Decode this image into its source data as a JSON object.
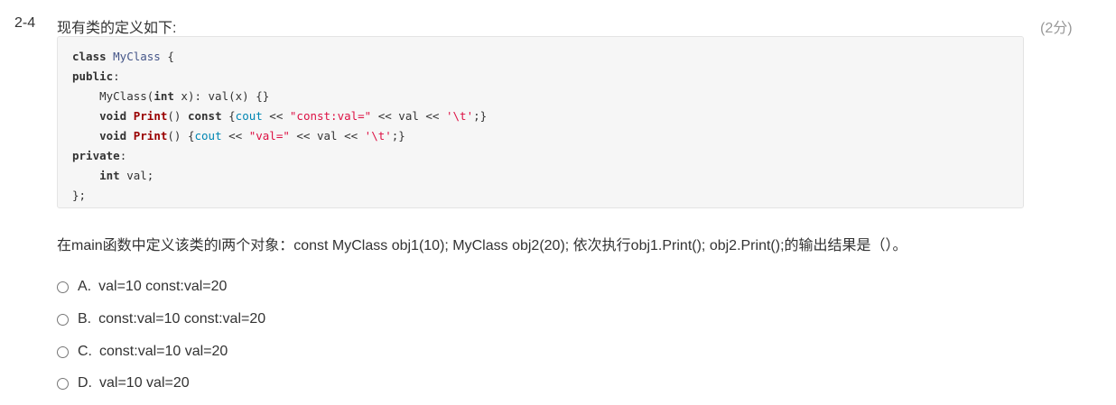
{
  "question": {
    "number": "2-4",
    "title": "现有类的定义如下:",
    "score": "(2分)",
    "code": [
      [
        [
          "class ",
          "kw"
        ],
        [
          "MyClass",
          "ty"
        ],
        [
          " {",
          "pl"
        ]
      ],
      [
        [
          "public",
          "kw"
        ],
        [
          ":",
          "pl"
        ]
      ],
      [
        [
          "    MyClass(",
          "pl"
        ],
        [
          "int",
          "kw"
        ],
        [
          " x): val(x) {}",
          "pl"
        ]
      ],
      [
        [
          "    ",
          "pl"
        ],
        [
          "void",
          "kw"
        ],
        [
          " ",
          "pl"
        ],
        [
          "Print",
          "fn"
        ],
        [
          "() ",
          "pl"
        ],
        [
          "const",
          "kw"
        ],
        [
          " {",
          "pl"
        ],
        [
          "cout",
          "bi"
        ],
        [
          " << ",
          "pl"
        ],
        [
          "\"const:val=\"",
          "st"
        ],
        [
          " << val << ",
          "pl"
        ],
        [
          "'\\t'",
          "st"
        ],
        [
          ";}",
          "pl"
        ]
      ],
      [
        [
          "    ",
          "pl"
        ],
        [
          "void",
          "kw"
        ],
        [
          " ",
          "pl"
        ],
        [
          "Print",
          "fn"
        ],
        [
          "() {",
          "pl"
        ],
        [
          "cout",
          "bi"
        ],
        [
          " << ",
          "pl"
        ],
        [
          "\"val=\"",
          "st"
        ],
        [
          " << val << ",
          "pl"
        ],
        [
          "'\\t'",
          "st"
        ],
        [
          ";}",
          "pl"
        ]
      ],
      [
        [
          "private",
          "kw"
        ],
        [
          ":",
          "pl"
        ]
      ],
      [
        [
          "    ",
          "pl"
        ],
        [
          "int",
          "kw"
        ],
        [
          " val;",
          "pl"
        ]
      ],
      [
        [
          "};",
          "pl"
        ]
      ]
    ],
    "prompt": "在main函数中定义该类的l两个对象：const MyClass obj1(10); MyClass obj2(20); 依次执行obj1.Print(); obj2.Print();的输出结果是（）。",
    "options": [
      {
        "label": "A.",
        "text": "val=10 const:val=20"
      },
      {
        "label": "B.",
        "text": "const:val=10 const:val=20"
      },
      {
        "label": "C.",
        "text": "const:val=10 val=20"
      },
      {
        "label": "D.",
        "text": "val=10 val=20"
      }
    ]
  }
}
